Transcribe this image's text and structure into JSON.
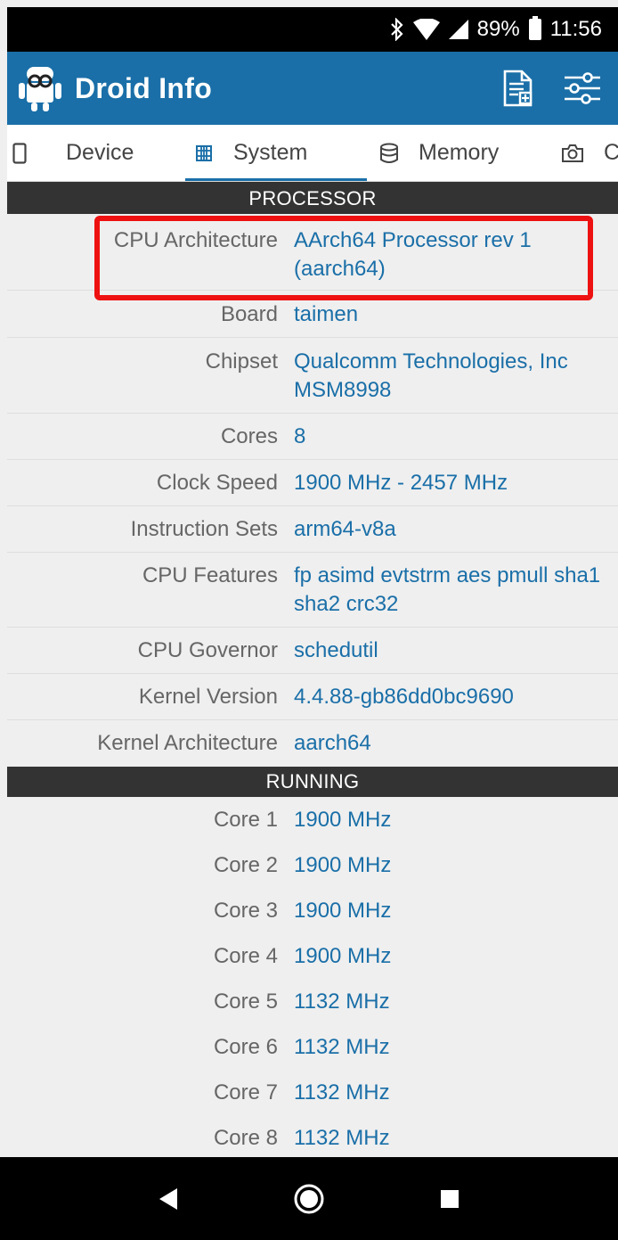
{
  "status_bar": {
    "battery_percent": "89%",
    "time": "11:56",
    "battery_level": 0.89
  },
  "app_bar": {
    "title": "Droid Info",
    "actions": [
      "report-icon",
      "settings-sliders-icon"
    ]
  },
  "tabs": [
    {
      "label": "Device",
      "icon": "phone-icon",
      "active": false
    },
    {
      "label": "System",
      "icon": "cpu-icon",
      "active": true
    },
    {
      "label": "Memory",
      "icon": "memory-icon",
      "active": false
    },
    {
      "label": "C",
      "icon": "camera-icon",
      "active": false
    }
  ],
  "processor": {
    "header": "PROCESSOR",
    "rows": [
      {
        "label": "CPU Architecture",
        "value": "AArch64 Processor rev 1 (aarch64)"
      },
      {
        "label": "Board",
        "value": "taimen"
      },
      {
        "label": "Chipset",
        "value": "Qualcomm Technologies, Inc MSM8998"
      },
      {
        "label": "Cores",
        "value": "8"
      },
      {
        "label": "Clock Speed",
        "value": "1900 MHz - 2457 MHz"
      },
      {
        "label": "Instruction Sets",
        "value": "arm64-v8a"
      },
      {
        "label": "CPU Features",
        "value": "fp asimd evtstrm aes pmull sha1 sha2 crc32"
      },
      {
        "label": "CPU Governor",
        "value": "schedutil"
      },
      {
        "label": "Kernel Version",
        "value": "4.4.88-gb86dd0bc9690"
      },
      {
        "label": "Kernel Architecture",
        "value": "aarch64"
      }
    ]
  },
  "running": {
    "header": "RUNNING",
    "rows": [
      {
        "label": "Core 1",
        "value": "1900 MHz"
      },
      {
        "label": "Core 2",
        "value": "1900 MHz"
      },
      {
        "label": "Core 3",
        "value": "1900 MHz"
      },
      {
        "label": "Core 4",
        "value": "1900 MHz"
      },
      {
        "label": "Core 5",
        "value": "1132 MHz"
      },
      {
        "label": "Core 6",
        "value": "1132 MHz"
      },
      {
        "label": "Core 7",
        "value": "1132 MHz"
      },
      {
        "label": "Core 8",
        "value": "1132 MHz"
      }
    ]
  },
  "highlight_color": "#ee1111",
  "accent_color": "#1a6fa8",
  "nav_bar": [
    "back-icon",
    "home-icon",
    "recents-icon"
  ]
}
